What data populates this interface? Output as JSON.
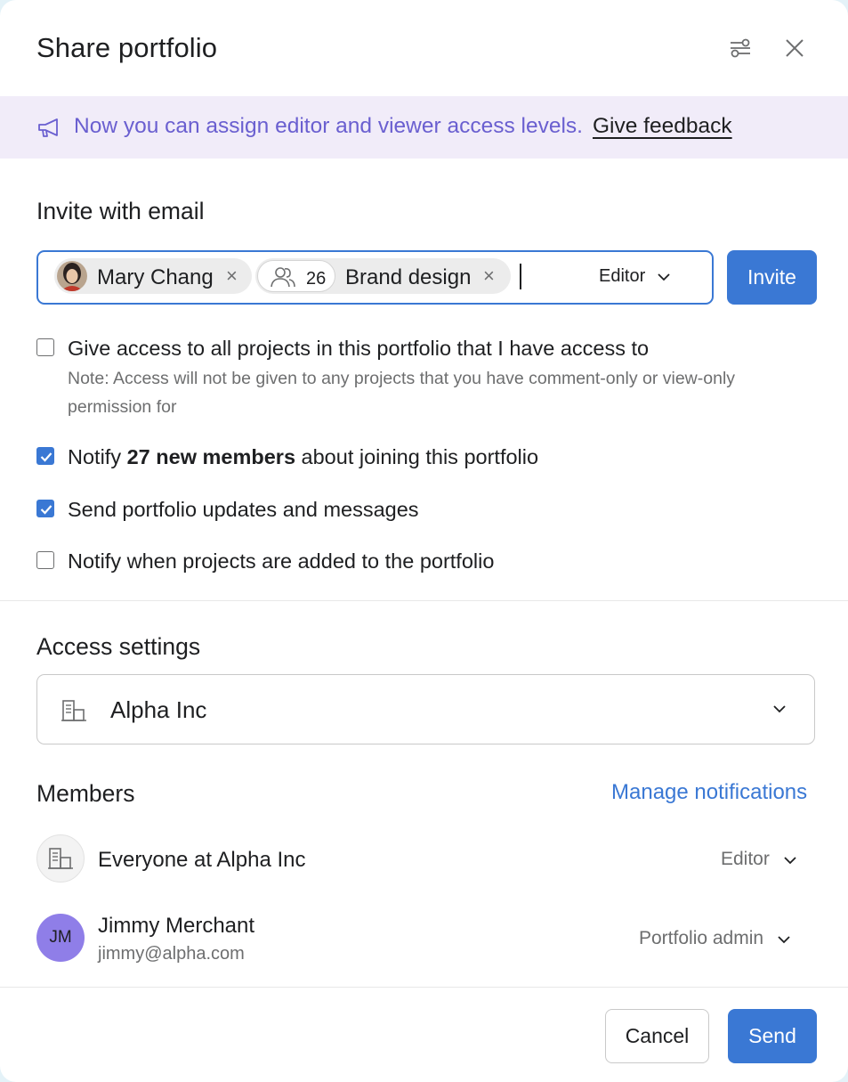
{
  "header": {
    "title": "Share portfolio",
    "settings_icon": "sliders-icon",
    "close_icon": "close-icon"
  },
  "banner": {
    "icon": "megaphone-icon",
    "text": "Now you can assign editor and viewer access levels.",
    "link": "Give feedback"
  },
  "invite": {
    "section_title": "Invite with email",
    "tokens": [
      {
        "label": "Mary Chang",
        "type": "person"
      },
      {
        "label": "Brand design",
        "type": "team",
        "count": "26"
      }
    ],
    "role": "Editor",
    "button": "Invite"
  },
  "options": [
    {
      "label": "Give access to all projects in this portfolio that I have access to",
      "checked": false,
      "note": "Note: Access will not be given to any projects that you have comment-only or view-only permission for"
    },
    {
      "label_pre": "Notify ",
      "label_bold": "27 new members",
      "label_post": " about joining this portfolio",
      "checked": true
    },
    {
      "label": "Send portfolio updates and messages",
      "checked": true
    },
    {
      "label": "Notify when projects are added to the portfolio",
      "checked": false
    }
  ],
  "access": {
    "section_title": "Access settings",
    "value": "Alpha Inc",
    "icon": "building-icon"
  },
  "members": {
    "section_title": "Members",
    "manage_link": "Manage notifications",
    "list": [
      {
        "name": "Everyone at Alpha Inc",
        "role": "Editor",
        "avatar": "building-icon"
      },
      {
        "name": "Jimmy Merchant",
        "email": "jimmy@alpha.com",
        "initials": "JM",
        "role": "Portfolio admin"
      }
    ]
  },
  "footer": {
    "cancel": "Cancel",
    "send": "Send"
  },
  "colors": {
    "accent": "#3a78d4",
    "banner_bg": "#f1ecf9",
    "banner_text": "#6a5fd0",
    "avatar_jm": "#8f7ee8"
  }
}
